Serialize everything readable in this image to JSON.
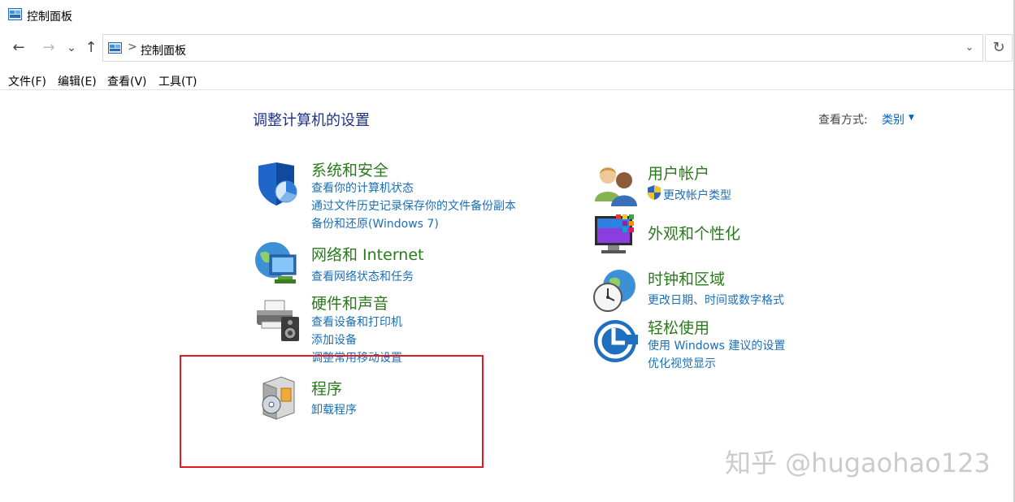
{
  "window": {
    "title": "控制面板"
  },
  "address_bar": {
    "path": "控制面板",
    "separator": ">"
  },
  "nav": {
    "back_icon": "←",
    "forward_icon": "→",
    "recent_icon": "⌄",
    "up_icon": "↑",
    "refresh_icon": "↻",
    "dropdown_icon": "⌄"
  },
  "menu": [
    "文件(F)",
    "编辑(E)",
    "查看(V)",
    "工具(T)"
  ],
  "page": {
    "title": "调整计算机的设置",
    "view_by_label": "查看方式:",
    "view_by_value": "类别",
    "view_by_caret": "▼"
  },
  "categories": {
    "system_security": {
      "title": "系统和安全",
      "links": [
        "查看你的计算机状态",
        "通过文件历史记录保存你的文件备份副本",
        "备份和还原(Windows 7)"
      ]
    },
    "network": {
      "title": "网络和 Internet",
      "links": [
        "查看网络状态和任务"
      ]
    },
    "hardware": {
      "title": "硬件和声音",
      "links": [
        "查看设备和打印机",
        "添加设备",
        "调整常用移动设置"
      ]
    },
    "programs": {
      "title": "程序",
      "links": [
        "卸载程序"
      ]
    },
    "user_accounts": {
      "title": "用户帐户",
      "links": [
        "更改帐户类型"
      ]
    },
    "appearance": {
      "title": "外观和个性化",
      "links": []
    },
    "clock_region": {
      "title": "时钟和区域",
      "links": [
        "更改日期、时间或数字格式"
      ]
    },
    "ease_of_access": {
      "title": "轻松使用",
      "links": [
        "使用 Windows 建议的设置",
        "优化视觉显示"
      ]
    }
  },
  "watermark": "知乎 @hugaohao123",
  "colors": {
    "category_title": "#2a7a1d",
    "link": "#1a6fb8",
    "page_title": "#1e3287",
    "highlight": "#e01b24"
  }
}
